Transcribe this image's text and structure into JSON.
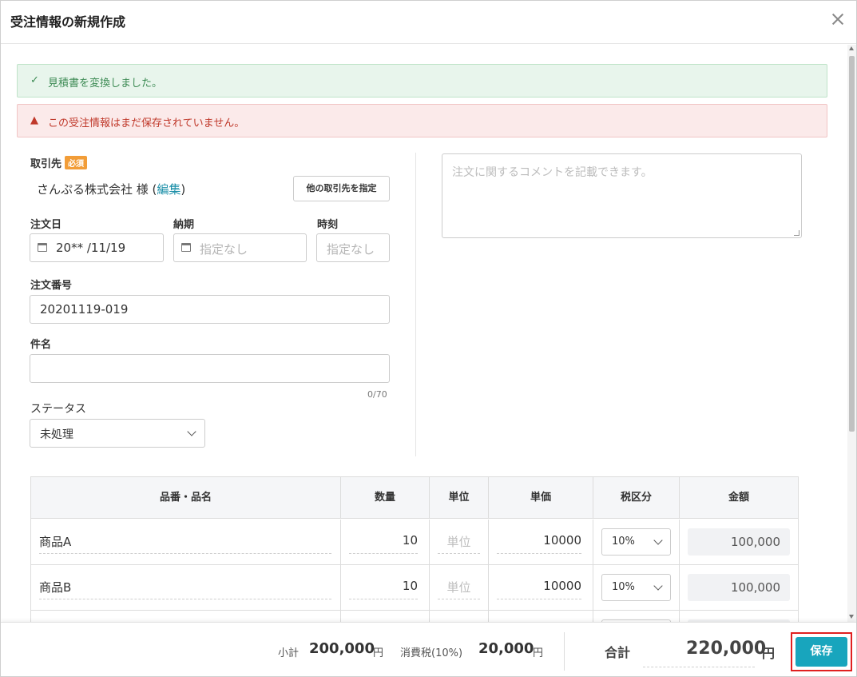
{
  "header": {
    "title": "受注情報の新規作成"
  },
  "alerts": {
    "success": "見積書を変換しました。",
    "error": "この受注情報はまだ保存されていません。"
  },
  "client": {
    "label": "取引先",
    "required": "必須",
    "name": "さんぷる株式会社 様 (",
    "edit": "編集",
    "name_close": ")",
    "change_button": "他の取引先を指定"
  },
  "order_date": {
    "label": "注文日",
    "value": "20** /11/19"
  },
  "delivery": {
    "label": "納期",
    "placeholder": "指定なし"
  },
  "time": {
    "label": "時刻",
    "placeholder": "指定なし"
  },
  "order_number": {
    "label": "注文番号",
    "value": "20201119-019"
  },
  "subject": {
    "label": "件名",
    "value": "",
    "counter": "0/70"
  },
  "status": {
    "label": "ステータス",
    "value": "未処理"
  },
  "comment": {
    "placeholder": "注文に関するコメントを記載できます。"
  },
  "table": {
    "headers": [
      "品番・品名",
      "数量",
      "単位",
      "単価",
      "税区分",
      "金額"
    ],
    "rows": [
      {
        "name": "商品A",
        "qty": "10",
        "unit": "単位",
        "price": "10000",
        "tax": "10%",
        "amount": "100,000"
      },
      {
        "name": "商品B",
        "qty": "10",
        "unit": "単位",
        "price": "10000",
        "tax": "10%",
        "amount": "100,000"
      }
    ]
  },
  "footer": {
    "subtotal_label": "小計",
    "subtotal_value": "200,000",
    "yen": "円",
    "tax_label": "消費税(10%)",
    "tax_value": "20,000",
    "total_label": "合計",
    "total_value": "220,000",
    "save_button": "保存"
  },
  "colors": {
    "accent": "#18a5bd",
    "success": "#3d8b54",
    "error": "#c0392b",
    "badge": "#f29d38",
    "highlight": "#e02020"
  }
}
